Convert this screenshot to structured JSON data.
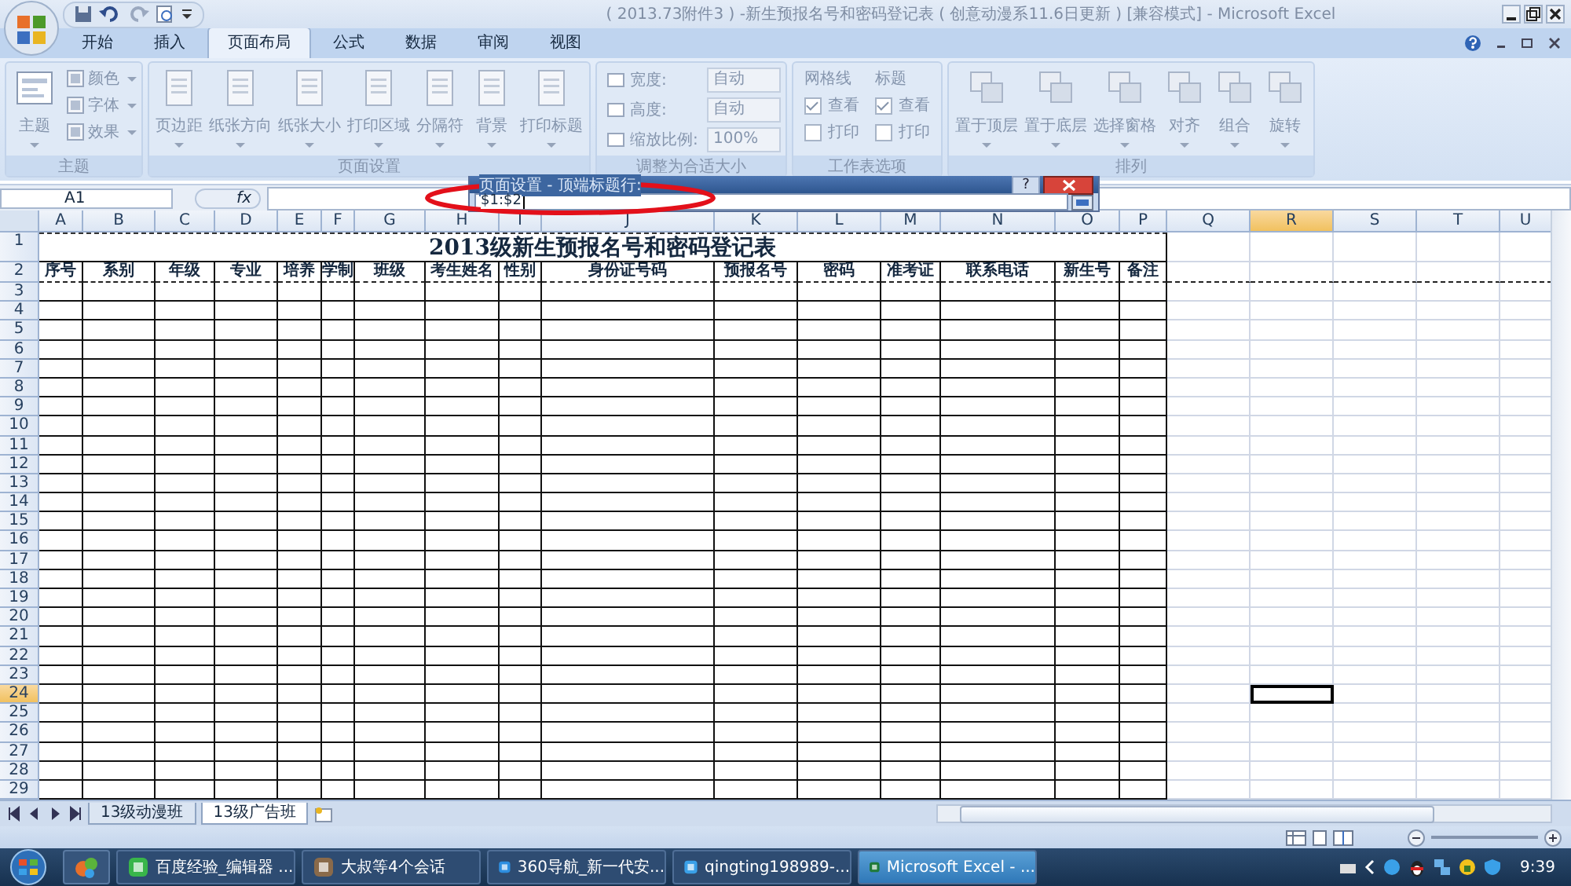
{
  "title_bar": {
    "title": "( 2013.73附件3 ) -新生预报名号和密码登记表 ( 创意动漫系11.6日更新 )  [兼容模式] - Microsoft Excel"
  },
  "tabs": [
    {
      "label": "开始",
      "selected": false
    },
    {
      "label": "插入",
      "selected": false
    },
    {
      "label": "页面布局",
      "selected": true
    },
    {
      "label": "公式",
      "selected": false
    },
    {
      "label": "数据",
      "selected": false
    },
    {
      "label": "审阅",
      "selected": false
    },
    {
      "label": "视图",
      "selected": false
    }
  ],
  "ribbon": {
    "disabled": true,
    "groups": [
      {
        "label": "主题",
        "kind": "themes",
        "items": [
          {
            "kind": "large",
            "label": "主题"
          },
          {
            "kind": "small",
            "label": "颜色"
          },
          {
            "kind": "small",
            "label": "字体"
          },
          {
            "kind": "small",
            "label": "效果"
          }
        ]
      },
      {
        "label": "页面设置",
        "kind": "page_setup",
        "items": [
          {
            "kind": "large",
            "label": "页边距"
          },
          {
            "kind": "large",
            "label": "纸张方向"
          },
          {
            "kind": "large",
            "label": "纸张大小"
          },
          {
            "kind": "large",
            "label": "打印区域"
          },
          {
            "kind": "large",
            "label": "分隔符"
          },
          {
            "kind": "large",
            "label": "背景"
          },
          {
            "kind": "large",
            "label": "打印标题"
          }
        ]
      },
      {
        "label": "调整为合适大小",
        "kind": "scale",
        "items": [
          {
            "kind": "field",
            "label": "宽度:",
            "value": "自动"
          },
          {
            "kind": "field",
            "label": "高度:",
            "value": "自动"
          },
          {
            "kind": "field",
            "label": "缩放比例:",
            "value": "100%"
          }
        ]
      },
      {
        "label": "工作表选项",
        "kind": "sheet_options",
        "items": [
          {
            "kind": "checks",
            "title": "网格线",
            "options": [
              {
                "label": "查看",
                "checked": true
              },
              {
                "label": "打印",
                "checked": false
              }
            ]
          },
          {
            "kind": "checks",
            "title": "标题",
            "options": [
              {
                "label": "查看",
                "checked": true
              },
              {
                "label": "打印",
                "checked": false
              }
            ]
          }
        ]
      },
      {
        "label": "排列",
        "kind": "arrange",
        "items": [
          {
            "kind": "large",
            "label": "置于顶层"
          },
          {
            "kind": "large",
            "label": "置于底层"
          },
          {
            "kind": "large",
            "label": "选择窗格"
          },
          {
            "kind": "large",
            "label": "对齐"
          },
          {
            "kind": "large",
            "label": "组合"
          },
          {
            "kind": "large",
            "label": "旋转"
          }
        ]
      }
    ]
  },
  "formula_bar": {
    "name_box": "A1",
    "function_label": "fx"
  },
  "dialog": {
    "title": "页面设置 - 顶端标题行:",
    "help": "?",
    "value": "$1:$2"
  },
  "sheet": {
    "title": "2013级新生预报名号和密码登记表",
    "columns": [
      {
        "label": "A",
        "selected": false
      },
      {
        "label": "B",
        "selected": false
      },
      {
        "label": "C",
        "selected": false
      },
      {
        "label": "D",
        "selected": false
      },
      {
        "label": "E",
        "selected": false
      },
      {
        "label": "F",
        "selected": false
      },
      {
        "label": "G",
        "selected": false
      },
      {
        "label": "H",
        "selected": false
      },
      {
        "label": "I",
        "selected": false
      },
      {
        "label": "J",
        "selected": false
      },
      {
        "label": "K",
        "selected": false
      },
      {
        "label": "L",
        "selected": false
      },
      {
        "label": "M",
        "selected": false
      },
      {
        "label": "N",
        "selected": false
      },
      {
        "label": "O",
        "selected": false
      },
      {
        "label": "P",
        "selected": false
      },
      {
        "label": "Q",
        "selected": false
      },
      {
        "label": "R",
        "selected": true
      },
      {
        "label": "S",
        "selected": false
      },
      {
        "label": "T",
        "selected": false
      },
      {
        "label": "U",
        "selected": false
      }
    ],
    "headers": [
      "序号",
      "系别",
      "年级",
      "专业",
      "培养",
      "学制",
      "班级",
      "考生姓名",
      "性别",
      "身份证号码",
      "预报名号",
      "密码",
      "准考证",
      "联系电话",
      "新生号",
      "备注"
    ],
    "rows": [
      {
        "label": "1",
        "selected": false
      },
      {
        "label": "2",
        "selected": false
      },
      {
        "label": "3",
        "selected": false
      },
      {
        "label": "4",
        "selected": false
      },
      {
        "label": "5",
        "selected": false
      },
      {
        "label": "6",
        "selected": false
      },
      {
        "label": "7",
        "selected": false
      },
      {
        "label": "8",
        "selected": false
      },
      {
        "label": "9",
        "selected": false
      },
      {
        "label": "10",
        "selected": false
      },
      {
        "label": "11",
        "selected": false
      },
      {
        "label": "12",
        "selected": false
      },
      {
        "label": "13",
        "selected": false
      },
      {
        "label": "14",
        "selected": false
      },
      {
        "label": "15",
        "selected": false
      },
      {
        "label": "16",
        "selected": false
      },
      {
        "label": "17",
        "selected": false
      },
      {
        "label": "18",
        "selected": false
      },
      {
        "label": "19",
        "selected": false
      },
      {
        "label": "20",
        "selected": false
      },
      {
        "label": "21",
        "selected": false
      },
      {
        "label": "22",
        "selected": false
      },
      {
        "label": "23",
        "selected": false
      },
      {
        "label": "24",
        "selected": true
      },
      {
        "label": "25",
        "selected": false
      },
      {
        "label": "26",
        "selected": false
      },
      {
        "label": "27",
        "selected": false
      },
      {
        "label": "28",
        "selected": false
      },
      {
        "label": "29",
        "selected": false
      }
    ]
  },
  "sheet_tabs": [
    {
      "label": "13级动漫班",
      "selected": false
    },
    {
      "label": "13级广告班",
      "selected": true
    }
  ],
  "taskbar": {
    "items": [
      {
        "label": "百度经验_编辑器 ...",
        "selected": false
      },
      {
        "label": "大叔等4个会话",
        "selected": false
      },
      {
        "label": "360导航_新一代安...",
        "selected": false
      },
      {
        "label": "qingting198989-...",
        "selected": false
      },
      {
        "label": "Microsoft Excel - ...",
        "selected": true
      }
    ],
    "clock": "9:39"
  }
}
